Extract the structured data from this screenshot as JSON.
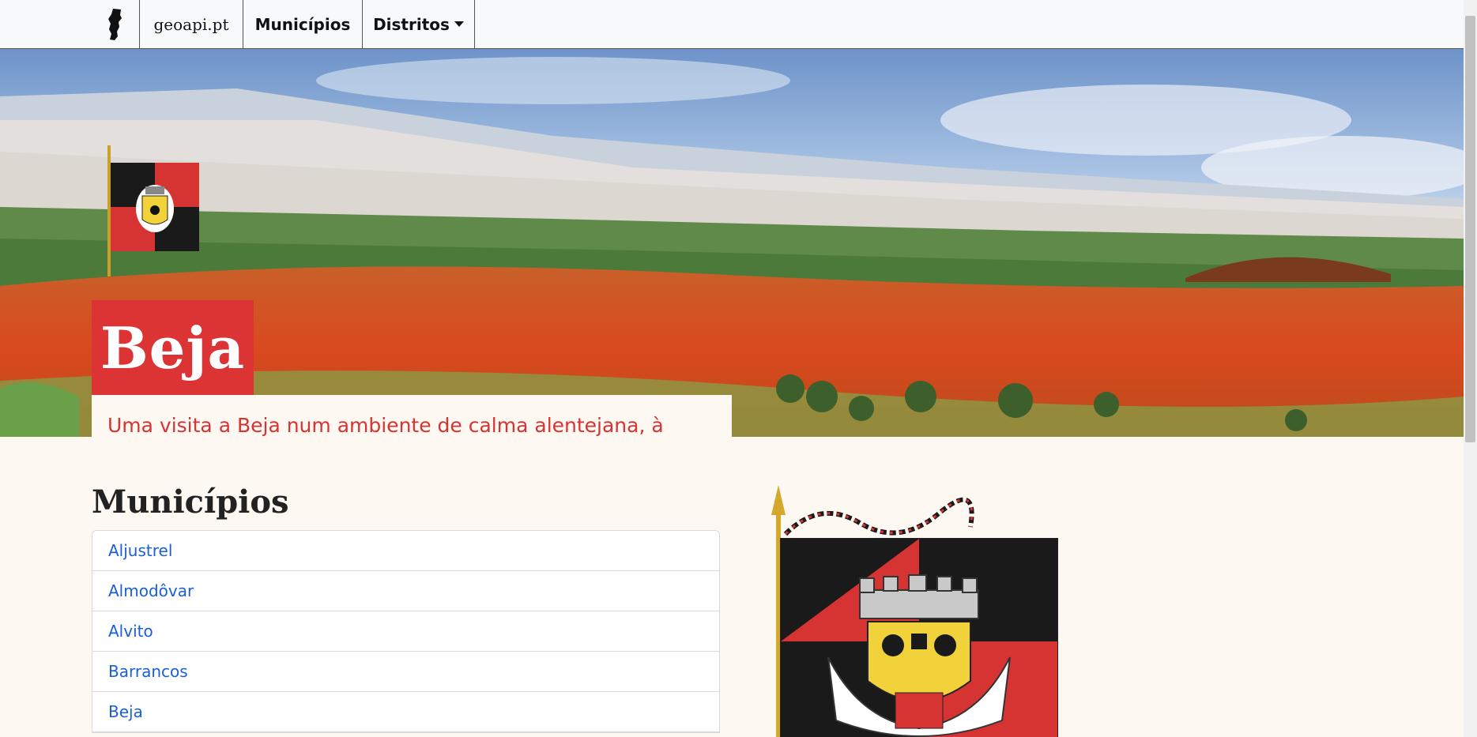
{
  "navbar": {
    "logo_icon": "portugal-map-icon",
    "brand": "geoapi.pt",
    "municipios": "Municípios",
    "distritos": "Distritos"
  },
  "hero": {
    "title": "Beja",
    "subtitle": "Uma visita a Beja num ambiente de calma alentejana, à descoberta de conquistas e de amores escondidos."
  },
  "main": {
    "section_title": "Municípios",
    "municipalities": [
      "Aljustrel",
      "Almodôvar",
      "Alvito",
      "Barrancos",
      "Beja"
    ]
  },
  "colors": {
    "accent_red": "#dc3434",
    "link_blue": "#1a5fd6",
    "page_bg": "#fdf8f1"
  }
}
